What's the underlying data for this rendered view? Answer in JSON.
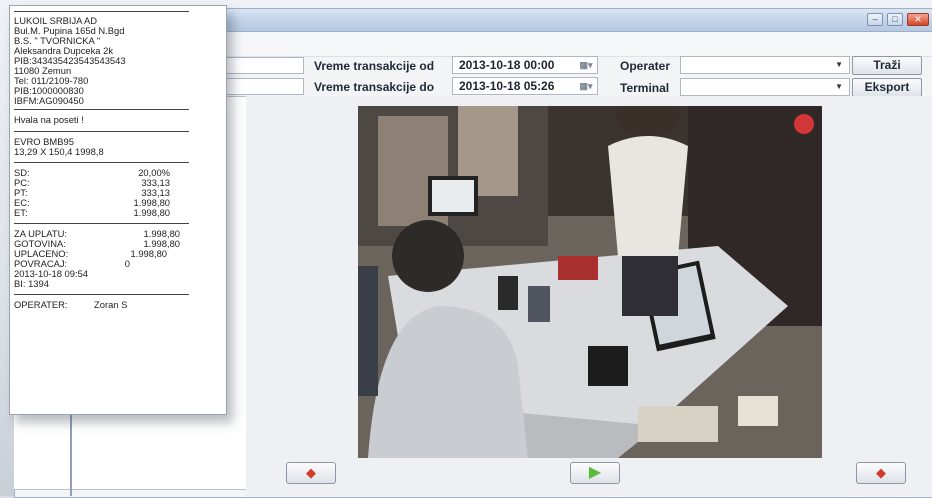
{
  "filters": {
    "from_label": "Vreme transakcije od",
    "from_value": "2013-10-18 00:00",
    "to_label": "Vreme transakcije do",
    "to_value": "2013-10-18 05:26",
    "operator_label": "Operater",
    "terminal_label": "Terminal",
    "search_button": "Traži",
    "export_button": "Eksport"
  },
  "receipt": {
    "header": [
      "LUKOIL SRBIJA AD",
      "Bul.M. Pupina 165d N.Bgd",
      "B.S.  \" TVORNICKA \"",
      "Aleksandra Dupceka 2k",
      "PIB:343435423543543543",
      "11080 Zemun",
      "Tel: 011/2109-780",
      "PIB:1000000830",
      "IBFM:AG090450"
    ],
    "thanks": "Hvala na poseti !",
    "product": "EVRO BMB95",
    "product_line": "13,29 X 150,4   1998,8",
    "taxes": [
      {
        "label": "SD:",
        "value": "20,00%"
      },
      {
        "label": "PC:",
        "value": "333,13"
      },
      {
        "label": "PT:",
        "value": "333,13"
      },
      {
        "label": "EC:",
        "value": "1.998,80"
      },
      {
        "label": "ET:",
        "value": "1.998,80"
      }
    ],
    "totals": [
      {
        "label": "ZA UPLATU:",
        "value": "1.998,80"
      },
      {
        "label": "GOTOVINA:",
        "value": "1.998,80"
      },
      {
        "label": "UPLACENO:",
        "value": "1.998,80"
      },
      {
        "label": "POVRACAJ:",
        "value": "0"
      }
    ],
    "datetime": "2013-10-18   09:54",
    "bi": "BI: 1394",
    "operator_label": "OPERATER:",
    "operator_name": "Zoran S"
  },
  "icons": {
    "calendar": "calendar-icon",
    "prev": "arrow-left-icon",
    "play": "play-icon",
    "next": "arrow-right-icon"
  }
}
